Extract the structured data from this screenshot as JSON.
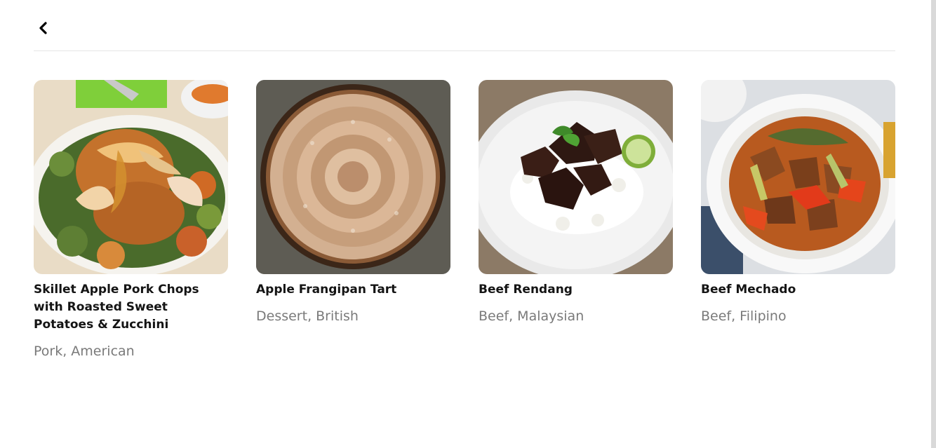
{
  "header": {
    "back_icon": "chevron-left-icon"
  },
  "recipes": [
    {
      "title": "Skillet Apple Pork Chops with Roasted Sweet Potatoes & Zucchini",
      "tags": "Pork, American"
    },
    {
      "title": "Apple Frangipan Tart",
      "tags": "Dessert, British"
    },
    {
      "title": "Beef Rendang",
      "tags": "Beef, Malaysian"
    },
    {
      "title": "Beef Mechado",
      "tags": "Beef, Filipino"
    }
  ],
  "colors": {
    "title": "#141414",
    "tags": "#7a7a7a",
    "divider": "#e6e6e6"
  }
}
